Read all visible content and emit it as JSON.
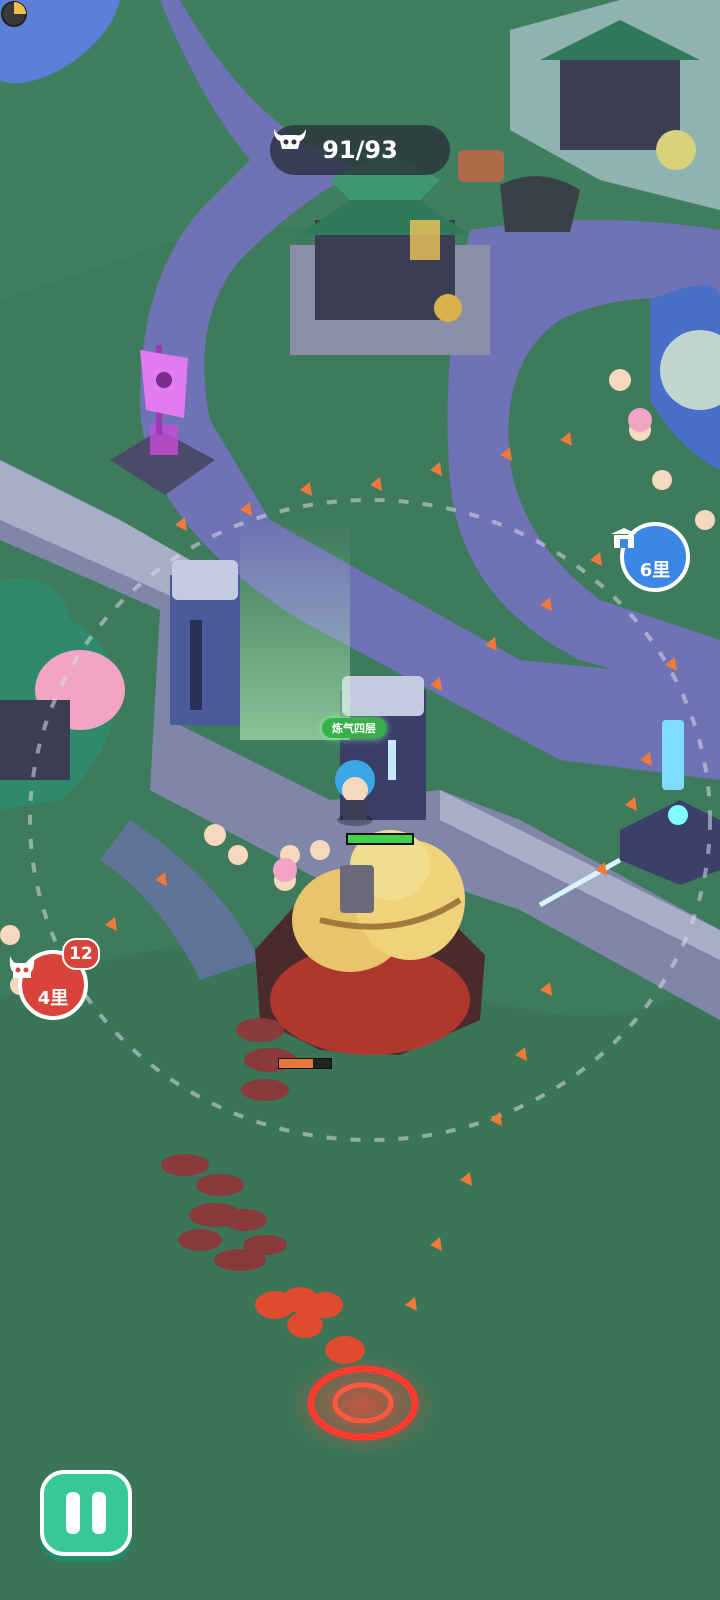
{
  "hud": {
    "kill_counter": {
      "icon": "bull-skull-icon",
      "value": "91/93"
    },
    "pause_icon": "pause-icon"
  },
  "player": {
    "realm_label": "炼气四层",
    "health_fraction": 1.0,
    "skill_cooldown_fraction": 0.25
  },
  "markers": {
    "gate_marker": {
      "icon": "gate-icon",
      "distance": "6里"
    },
    "demon_marker": {
      "icon": "demon-icon",
      "distance": "4里",
      "count": "12"
    }
  },
  "enemy": {
    "health_fraction": 0.65
  },
  "colors": {
    "grass": "#3e7a5c",
    "path": "#6c6fb0",
    "pause_button": "#36c997",
    "gate_marker": "#3b86e6",
    "demon_marker": "#d8443b",
    "direction_arrows": "#f07a3a"
  }
}
